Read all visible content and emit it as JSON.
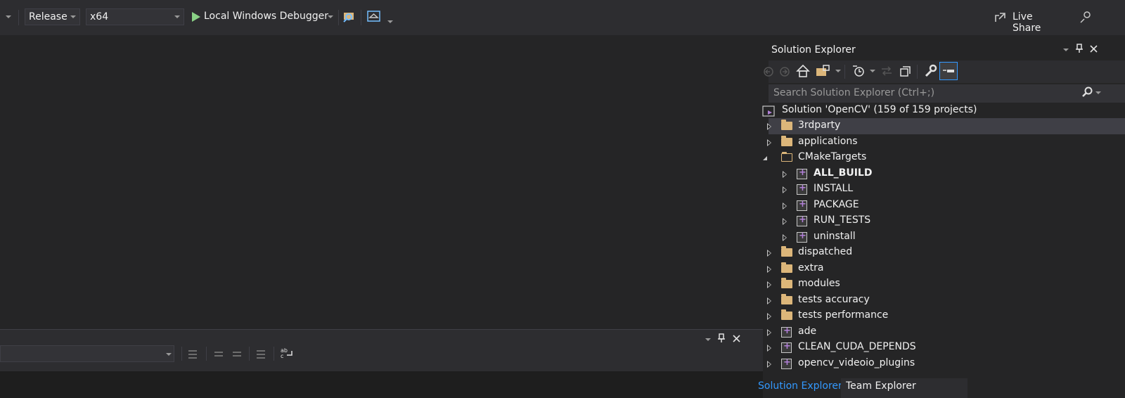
{
  "toolbar": {
    "config": "Release",
    "platform": "x64",
    "debugger": "Local Windows Debugger",
    "live_share": "Live Share",
    "accent_play": "#89d185"
  },
  "solution_explorer": {
    "title": "Solution Explorer",
    "search_placeholder": "Search Solution Explorer (Ctrl+;)",
    "solution_label": "Solution 'OpenCV' (159 of 159 projects)",
    "items": [
      {
        "label": "3rdparty",
        "kind": "folder",
        "level": 0,
        "expanded": false,
        "selected": true
      },
      {
        "label": "applications",
        "kind": "folder",
        "level": 0,
        "expanded": false
      },
      {
        "label": "CMakeTargets",
        "kind": "folder",
        "level": 0,
        "expanded": true
      },
      {
        "label": "ALL_BUILD",
        "kind": "project",
        "level": 1,
        "expanded": false,
        "bold": true
      },
      {
        "label": "INSTALL",
        "kind": "project",
        "level": 1,
        "expanded": false
      },
      {
        "label": "PACKAGE",
        "kind": "project",
        "level": 1,
        "expanded": false
      },
      {
        "label": "RUN_TESTS",
        "kind": "project",
        "level": 1,
        "expanded": false
      },
      {
        "label": "uninstall",
        "kind": "project",
        "level": 1,
        "expanded": false
      },
      {
        "label": "dispatched",
        "kind": "folder",
        "level": 0,
        "expanded": false
      },
      {
        "label": "extra",
        "kind": "folder",
        "level": 0,
        "expanded": false
      },
      {
        "label": "modules",
        "kind": "folder",
        "level": 0,
        "expanded": false
      },
      {
        "label": "tests accuracy",
        "kind": "folder",
        "level": 0,
        "expanded": false
      },
      {
        "label": "tests performance",
        "kind": "folder",
        "level": 0,
        "expanded": false
      },
      {
        "label": "ade",
        "kind": "project",
        "level": 0,
        "expanded": false
      },
      {
        "label": "CLEAN_CUDA_DEPENDS",
        "kind": "project",
        "level": 0,
        "expanded": false
      },
      {
        "label": "opencv_videoio_plugins",
        "kind": "project",
        "level": 0,
        "expanded": false
      }
    ],
    "tabs": [
      "Solution Explorer",
      "Team Explorer"
    ]
  }
}
